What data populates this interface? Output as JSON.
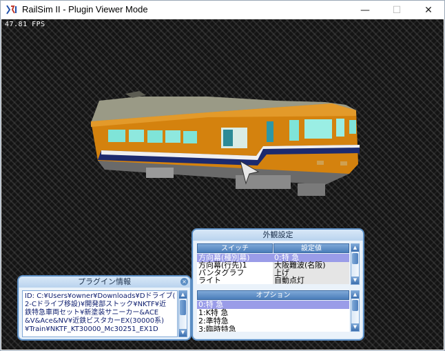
{
  "window": {
    "title": "RailSim II - Plugin Viewer Mode",
    "minimize": "—",
    "maximize": "☐",
    "close": "✕"
  },
  "viewport": {
    "fps": "47.81 FPS"
  },
  "appearance": {
    "title": "外観設定",
    "col_switch": "スイッチ",
    "col_value": "設定値",
    "rows": [
      {
        "name": "方向幕(種別幕)",
        "value": "0:特 急",
        "selected": true
      },
      {
        "name": "方向幕(行先)1",
        "value": "大阪難波(名阪)",
        "selected": false
      },
      {
        "name": "パンタグラフ",
        "value": "上げ",
        "selected": false
      },
      {
        "name": "ライト",
        "value": "自動点灯",
        "selected": false
      }
    ],
    "options_title": "オプション",
    "options": [
      {
        "label": "0:特 急",
        "selected": true
      },
      {
        "label": "1:K特 急",
        "selected": false
      },
      {
        "label": "2:準特急",
        "selected": false
      },
      {
        "label": "3:臨時特急",
        "selected": false
      }
    ]
  },
  "plugin": {
    "title": "プラグイン情報",
    "close": "×",
    "lines": [
      "ID: C:¥Users¥owner¥Downloads¥Dドライブ(",
      "2-Cドライブ移設)¥開発部ストック¥NKTF¥近",
      "鉄特急車両セット¥新塗装サニーカー&ACE",
      "&V&Ace&NV¥近鉄ビスタカーEX(30000系)",
      "¥Train¥NKTF_KT30000_Mc30251_EX1D"
    ]
  },
  "colors": {
    "train_body": "#d4820e",
    "train_stripe": "#1c2a6e",
    "panel_border": "#5b8ec4",
    "selection": "#9a9ce8"
  }
}
